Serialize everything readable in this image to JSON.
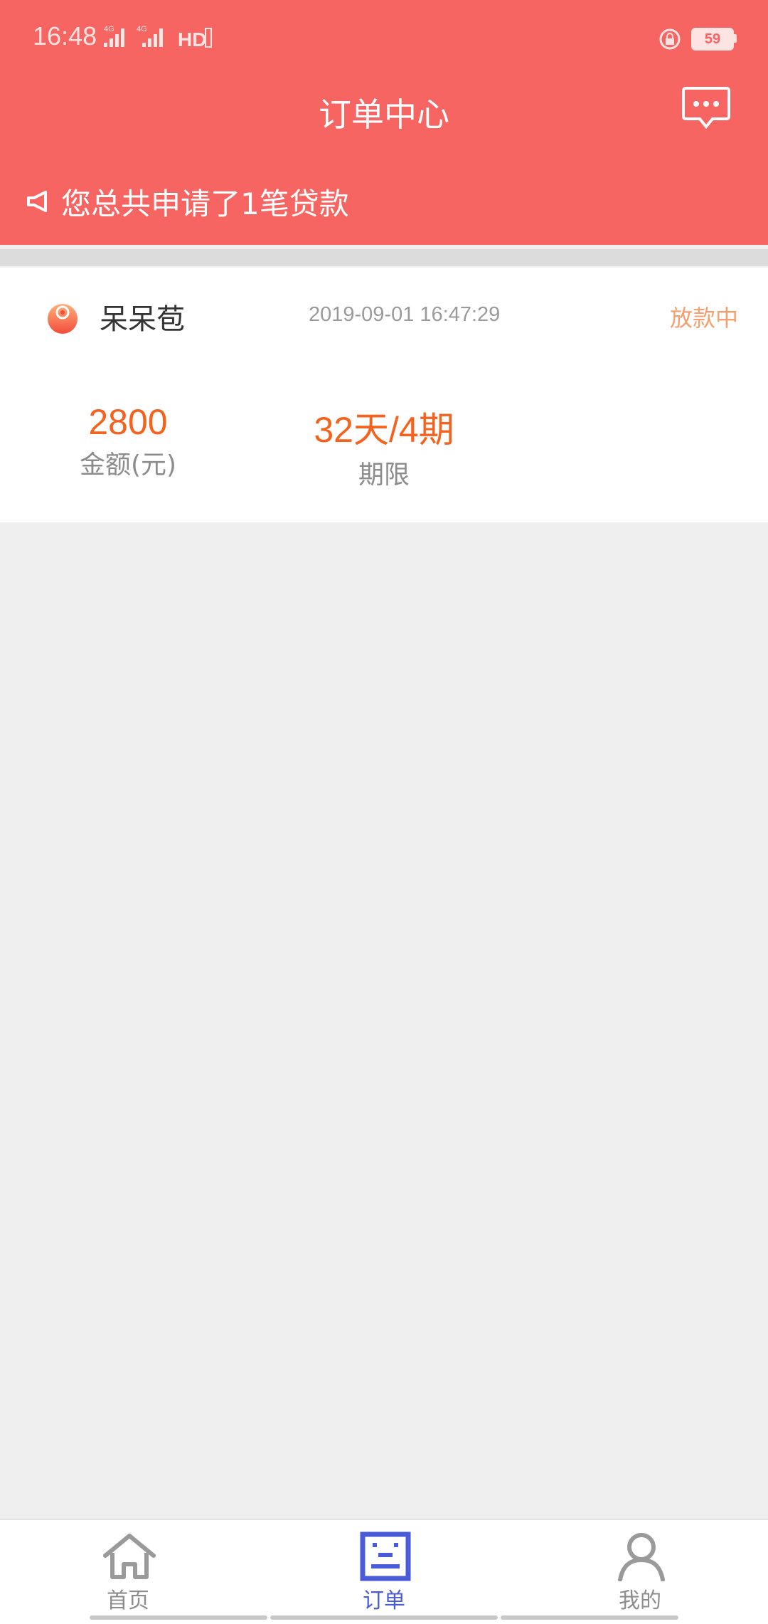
{
  "status_bar": {
    "time": "16:48",
    "network_1": "4G",
    "network_2": "4G",
    "hd_label": "HD",
    "battery": "59",
    "icons": [
      "signal-icon",
      "signal-icon",
      "hd-call-icon",
      "rotation-lock-icon",
      "battery-icon"
    ]
  },
  "header": {
    "title": "订单中心",
    "message_icon": "message-icon",
    "notice_icon": "speaker-icon",
    "notice_text": "您总共申请了1笔贷款",
    "background_color": "#f76563"
  },
  "order": {
    "product_name": "呆呆苞",
    "time": "2019-09-01 16:47:29",
    "status": "放款中",
    "status_color": "#f5a06e",
    "amount_value": "2800",
    "amount_label": "金额(元)",
    "term_value": "32天/4期",
    "term_label": "期限",
    "value_color": "#f5621e"
  },
  "tabbar": {
    "tabs": [
      {
        "label": "首页",
        "icon": "home-icon",
        "active": false
      },
      {
        "label": "订单",
        "icon": "orders-icon",
        "active": true
      },
      {
        "label": "我的",
        "icon": "profile-icon",
        "active": false
      }
    ],
    "active_color": "#4a5bd9"
  }
}
